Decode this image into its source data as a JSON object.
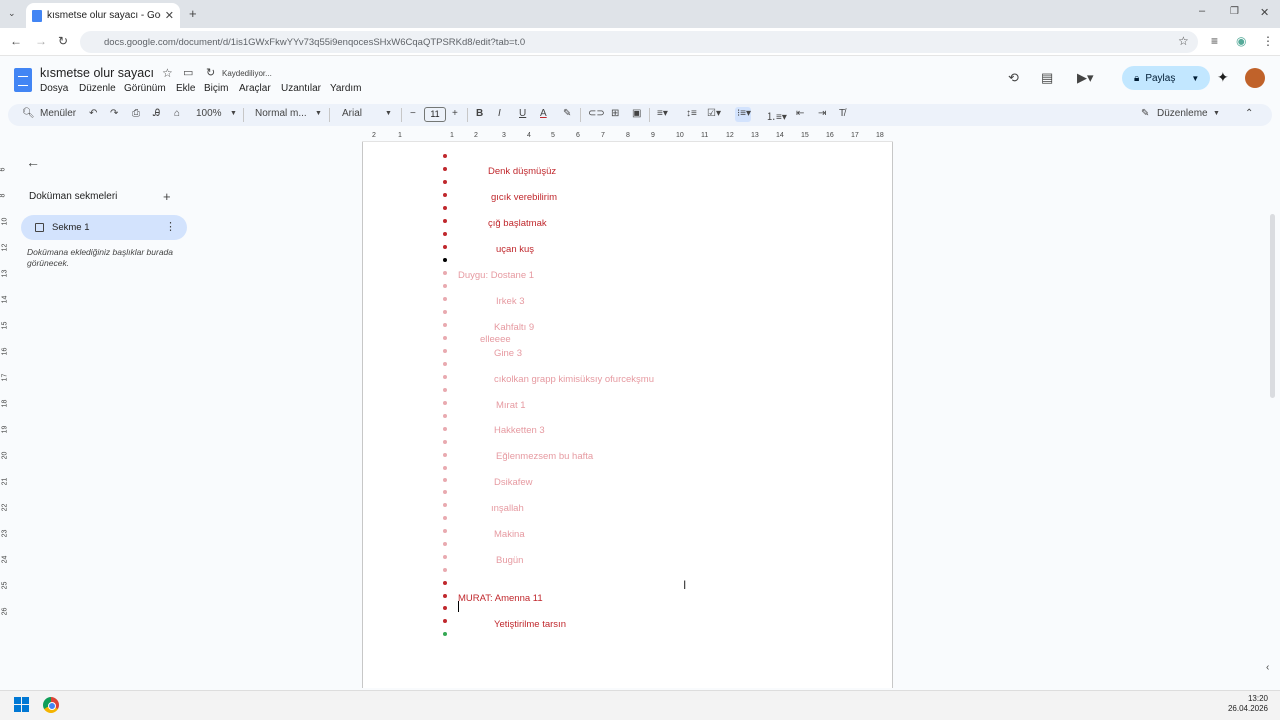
{
  "browser": {
    "tab_title": "kısmetse olur sayacı - Google D",
    "url": "docs.google.com/document/d/1is1GWxFkwYYv73q55i9enqocesSHxW6CqaQTPSRKd8/edit?tab=t.0"
  },
  "doc": {
    "title": "kısmetse olur sayacı",
    "save_status": "Kaydediliyor...",
    "menus": [
      "Dosya",
      "Düzenle",
      "Görünüm",
      "Ekle",
      "Biçim",
      "Araçlar",
      "Uzantılar",
      "Yardım"
    ],
    "share_label": "Paylaş"
  },
  "toolbar": {
    "menus_label": "Menüler",
    "zoom": "100%",
    "style": "Normal m...",
    "font": "Arial",
    "font_size": "11",
    "mode": "Düzenleme"
  },
  "ruler": [
    "2",
    "1",
    "1",
    "2",
    "3",
    "4",
    "5",
    "6",
    "7",
    "8",
    "9",
    "10",
    "11",
    "12",
    "13",
    "14",
    "15",
    "16",
    "17",
    "18"
  ],
  "vruler": [
    "6",
    "8",
    "10",
    "12",
    "13",
    "14",
    "15",
    "16",
    "17",
    "18",
    "19",
    "20",
    "21",
    "22",
    "23",
    "24",
    "25",
    "26"
  ],
  "sidebar": {
    "header": "Doküman sekmeleri",
    "tab_label": "Sekme 1",
    "hint": "Dokümana eklediğiniz başlıklar burada görünecek."
  },
  "lines": [
    {
      "text": "Denk düşmüşüz",
      "color": "red"
    },
    {
      "text": "gıcık verebilirim",
      "color": "red"
    },
    {
      "text": "çığ başlatmak",
      "color": "red"
    },
    {
      "text": "uçan kuş",
      "color": "red"
    },
    {
      "text": "Duygu: Dostane  1",
      "color": "pink"
    },
    {
      "text": "Irkek   3",
      "color": "pink"
    },
    {
      "text": "Kahfaltı 9",
      "color": "pink"
    },
    {
      "text": "elleeee",
      "color": "pink"
    },
    {
      "text": "Gine 3",
      "color": "pink"
    },
    {
      "text": "cıkolkan grapp kimisüksıy ofurcekşmu",
      "color": "pink"
    },
    {
      "text": "Mırat 1",
      "color": "pink"
    },
    {
      "text": "Hakketten 3",
      "color": "pink"
    },
    {
      "text": "Eğlenmezsem bu hafta",
      "color": "pink"
    },
    {
      "text": "Dsikafew",
      "color": "pink"
    },
    {
      "text": "ınşallah",
      "color": "pink"
    },
    {
      "text": "Makina",
      "color": "pink"
    },
    {
      "text": "Bugün",
      "color": "pink"
    },
    {
      "text": "MURAT: Amenna 11",
      "color": "red"
    },
    {
      "text": "Yetiştirilme tarsın",
      "color": "red"
    }
  ],
  "taskbar": {
    "time": "13:20",
    "date": "26.04.2026"
  }
}
